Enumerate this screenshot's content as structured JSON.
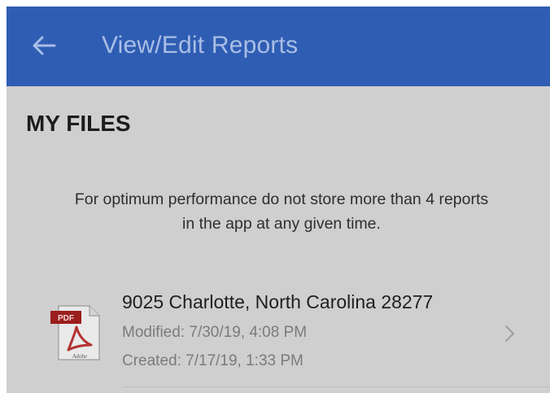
{
  "app_bar": {
    "title": "View/Edit Reports",
    "back_icon": "arrow-left-icon",
    "background_color": "#2f5db3"
  },
  "section": {
    "title": "MY FILES"
  },
  "notice": {
    "line1": "For optimum performance do not store more than 4 reports",
    "line2": "in the app at any given time."
  },
  "files": [
    {
      "icon": "pdf-file-icon",
      "icon_badge": "PDF",
      "icon_caption": "Adobe",
      "name": "9025 Charlotte, North Carolina 28277",
      "modified": "Modified: 7/30/19, 4:08 PM",
      "created": "Created: 7/17/19, 1:33 PM",
      "chevron_icon": "chevron-right-icon"
    }
  ]
}
